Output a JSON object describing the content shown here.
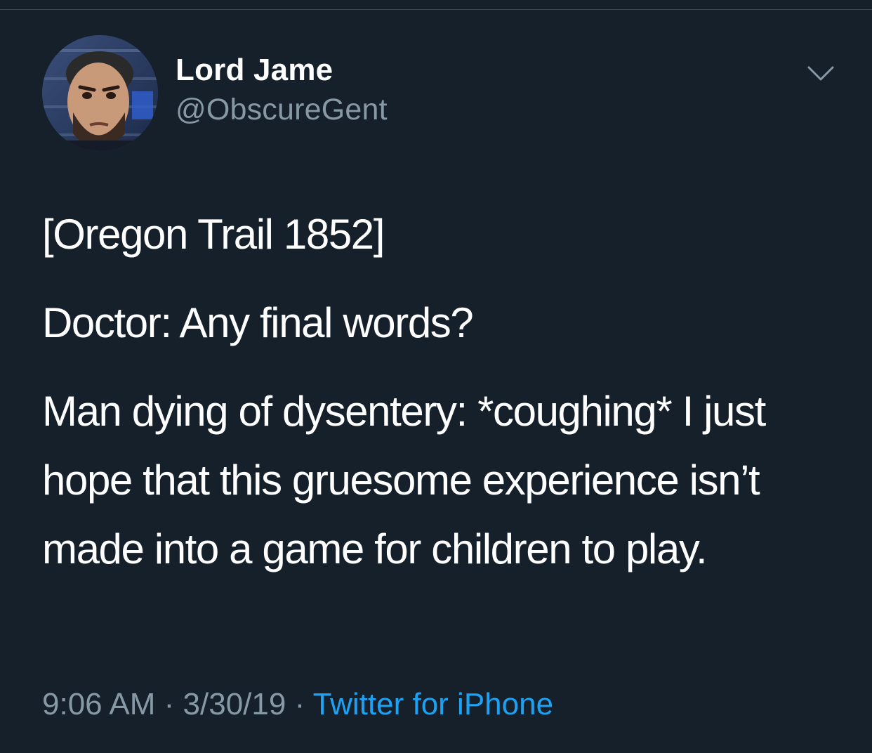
{
  "author": {
    "display_name": "Lord Jame",
    "handle": "@ObscureGent",
    "avatar_icon": "profile-photo"
  },
  "tweet": {
    "lines": [
      "[Oregon Trail 1852]",
      "Doctor: Any final words?",
      "Man dying of dysentery: *coughing* I just hope that this gruesome experience isn’t made into a game for children to play."
    ]
  },
  "meta": {
    "time": "9:06 AM",
    "separator": " · ",
    "date": "3/30/19",
    "source": "Twitter for iPhone"
  },
  "icons": {
    "caret": "chevron-down-icon"
  },
  "colors": {
    "background": "#15202b",
    "text_primary": "#ffffff",
    "text_secondary": "#8899a6",
    "link": "#1da1f2",
    "divider": "#38444d"
  }
}
